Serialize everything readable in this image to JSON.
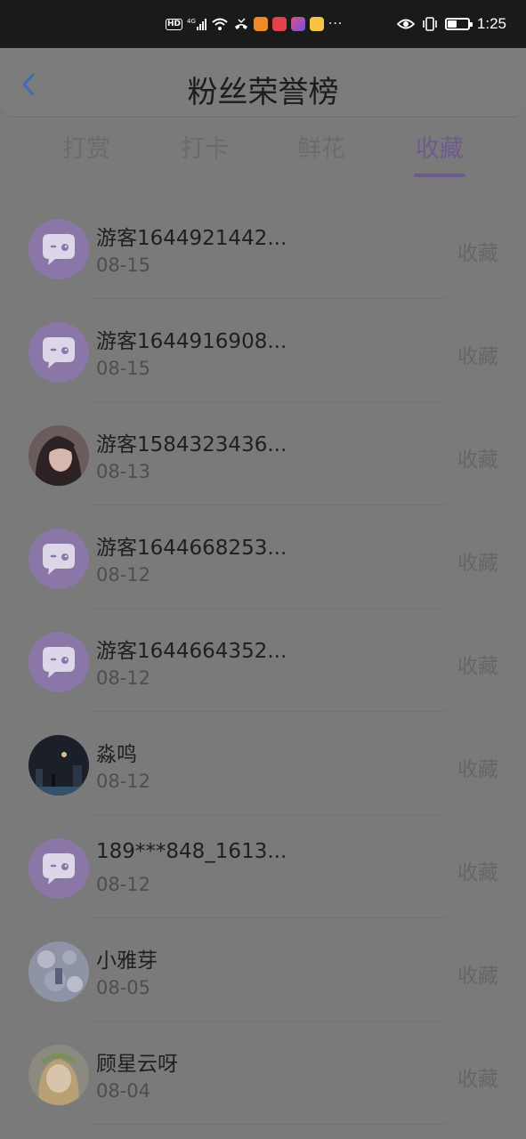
{
  "status_bar": {
    "hd": "HD",
    "network": "4G",
    "dots": "···",
    "time": "1:25"
  },
  "header": {
    "title": "粉丝荣誉榜",
    "back_icon": "chevron-left-icon"
  },
  "tabs": [
    {
      "label": "打赏",
      "active": false
    },
    {
      "label": "打卡",
      "active": false
    },
    {
      "label": "鲜花",
      "active": false
    },
    {
      "label": "收藏",
      "active": true
    }
  ],
  "colors": {
    "accent": "#6e5a8f",
    "avatar_default": "#8a77a8"
  },
  "fans": [
    {
      "name": "游客1644921442...",
      "date": "08-15",
      "action": "收藏",
      "avatar": "default-chat-avatar"
    },
    {
      "name": "游客1644916908...",
      "date": "08-15",
      "action": "收藏",
      "avatar": "default-chat-avatar"
    },
    {
      "name": "游客1584323436...",
      "date": "08-13",
      "action": "收藏",
      "avatar": "photo-girl-avatar"
    },
    {
      "name": "游客1644668253...",
      "date": "08-12",
      "action": "收藏",
      "avatar": "default-chat-avatar"
    },
    {
      "name": "游客1644664352...",
      "date": "08-12",
      "action": "收藏",
      "avatar": "default-chat-avatar"
    },
    {
      "name": "淼鸣",
      "date": "08-12",
      "action": "收藏",
      "avatar": "night-scene-avatar"
    },
    {
      "name": "189***848_1613...",
      "date": "08-12",
      "action": "收藏",
      "avatar": "default-chat-avatar"
    },
    {
      "name": "小雅芽",
      "date": "08-05",
      "action": "收藏",
      "avatar": "blossom-avatar"
    },
    {
      "name": "顾星云呀",
      "date": "08-04",
      "action": "收藏",
      "avatar": "anime-girl-avatar"
    }
  ]
}
